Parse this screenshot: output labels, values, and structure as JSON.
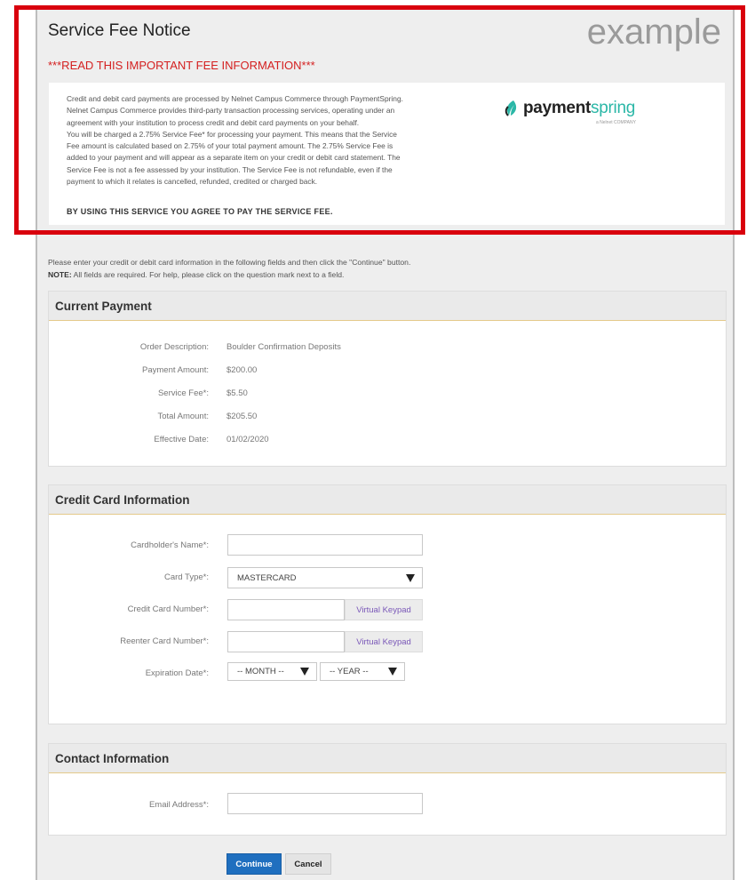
{
  "notice": {
    "title": "Service Fee Notice",
    "example_label": "example",
    "warning": "***READ THIS IMPORTANT FEE INFORMATION***",
    "lines": [
      "Credit and debit card payments are processed by Nelnet Campus Commerce through PaymentSpring.",
      "Nelnet Campus Commerce provides third-party transaction processing services, operating under an",
      "agreement with your institution to process credit and debit card payments on your behalf.",
      "You will be charged a 2.75% Service Fee* for processing your payment. This means that the Service",
      "Fee amount is calculated based on 2.75% of your total payment amount. The 2.75% Service Fee is",
      "added to your payment and will appear as a separate item on your credit or debit card statement. The",
      "Service Fee is not a fee assessed by your institution. The Service Fee is not refundable, even if the",
      "payment to which it relates is cancelled, refunded, credited or charged back."
    ],
    "agree": "BY USING THIS SERVICE YOU AGREE TO PAY THE SERVICE FEE.",
    "logo_word_bold": "payment",
    "logo_word_light": "spring",
    "logo_sub": "a Nelnet COMPANY"
  },
  "instructions": {
    "line1": "Please enter your credit or debit card information in the following fields and then click the \"Continue\" button.",
    "note_label": "NOTE:",
    "note_text": " All fields are required. For help, please click on the question mark next to a field."
  },
  "current_payment": {
    "header": "Current Payment",
    "rows": [
      {
        "label": "Order Description:",
        "value": "Boulder Confirmation Deposits"
      },
      {
        "label": "Payment Amount:",
        "value": "$200.00"
      },
      {
        "label": "Service Fee*:",
        "value": "$5.50"
      },
      {
        "label": "Total Amount:",
        "value": "$205.50"
      },
      {
        "label": "Effective Date:",
        "value": "01/02/2020"
      }
    ]
  },
  "card_info": {
    "header": "Credit Card Information",
    "name_label": "Cardholder's Name*:",
    "type_label": "Card Type*:",
    "type_value": "MASTERCARD",
    "number_label": "Credit Card Number*:",
    "reenter_label": "Reenter Card Number*:",
    "keypad_label": "Virtual Keypad",
    "expiry_label": "Expiration Date*:",
    "month_value": "-- MONTH --",
    "year_value": "-- YEAR --"
  },
  "contact": {
    "header": "Contact Information",
    "email_label": "Email Address*:"
  },
  "actions": {
    "continue": "Continue",
    "cancel": "Cancel"
  },
  "colors": {
    "highlight_border": "#d9000d",
    "warning_text": "#d42020",
    "continue_button": "#1f6fbf",
    "keypad_text": "#7a58b8",
    "logo_accent": "#2bb7a7"
  }
}
